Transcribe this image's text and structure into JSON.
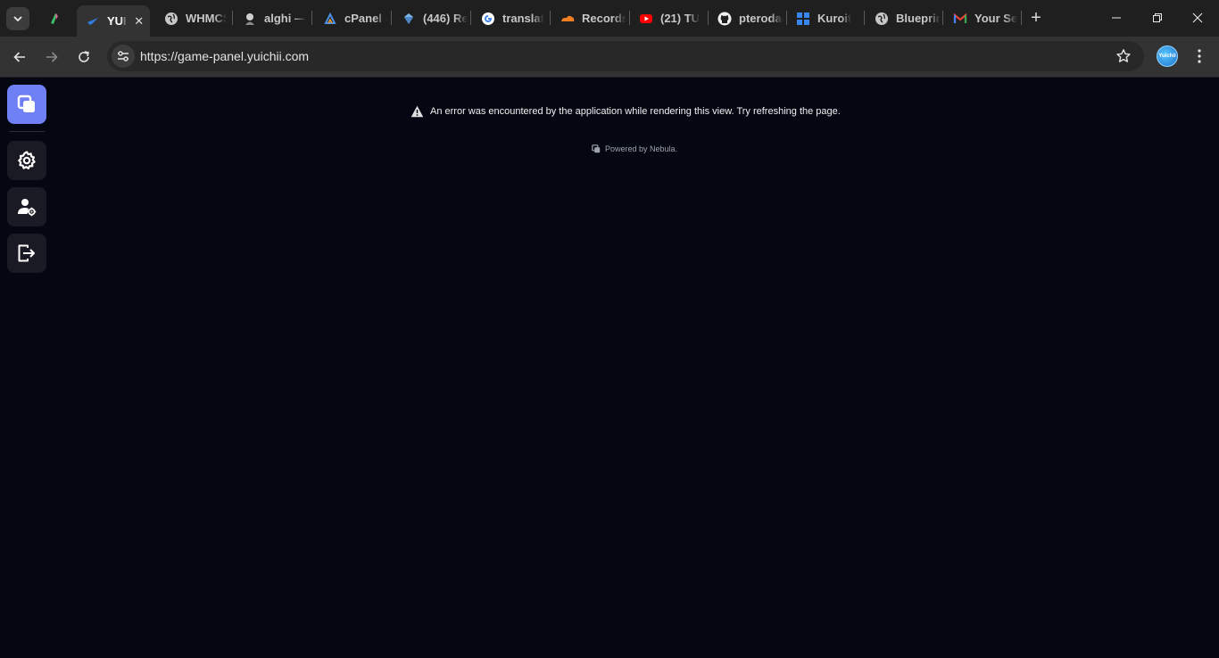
{
  "browser": {
    "tabs": [
      {
        "title": "YUI",
        "active": true,
        "favicon": "yuichii-icon"
      },
      {
        "title": "WHMCS",
        "favicon": "globe-icon"
      },
      {
        "title": "alghi —",
        "favicon": "avatar-icon"
      },
      {
        "title": "cPanel -",
        "favicon": "cpanel-icon"
      },
      {
        "title": "(446) Re",
        "favicon": "gem-icon"
      },
      {
        "title": "translat",
        "favicon": "google-icon"
      },
      {
        "title": "Records",
        "favicon": "cloudflare-icon"
      },
      {
        "title": "(21) TU",
        "favicon": "youtube-icon"
      },
      {
        "title": "pterodac",
        "favicon": "github-icon"
      },
      {
        "title": "Kuroit",
        "favicon": "kuroit-icon"
      },
      {
        "title": "Blueprin",
        "favicon": "globe-icon"
      },
      {
        "title": "Your Se",
        "favicon": "gmail-icon"
      }
    ],
    "tab_close_glyph": "✕",
    "new_tab_glyph": "+",
    "address": "https://game-panel.yuichii.com",
    "profile_label": "Yuichii"
  },
  "sidebar": {
    "items": [
      {
        "name": "home",
        "icon": "layers-icon"
      },
      {
        "name": "settings",
        "icon": "gear-icon"
      },
      {
        "name": "account",
        "icon": "user-cog-icon"
      },
      {
        "name": "logout",
        "icon": "logout-icon"
      }
    ]
  },
  "main": {
    "error_message": "An error was encountered by the application while rendering this view. Try refreshing the page.",
    "powered_by": "Powered by Nebula."
  },
  "colors": {
    "page_bg": "#040712",
    "accent": "#6f80f5",
    "sidebar_btn": "#1a1a24"
  }
}
